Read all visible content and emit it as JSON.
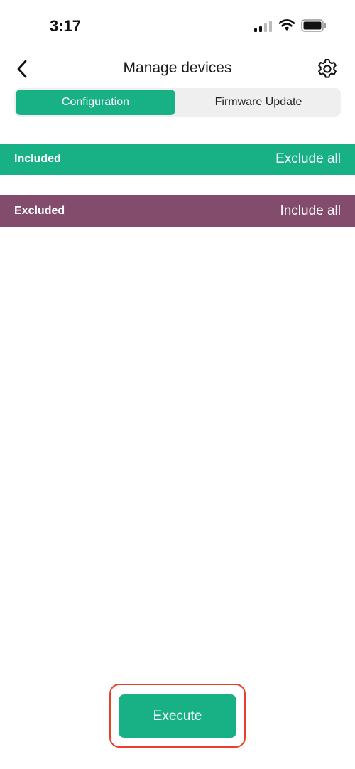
{
  "status_bar": {
    "time": "3:17",
    "icons": [
      "signal-icon",
      "wifi-icon",
      "battery-icon"
    ]
  },
  "nav": {
    "title": "Manage devices",
    "back_icon": "chevron-left-icon",
    "settings_icon": "gear-icon"
  },
  "tabs": [
    {
      "label": "Configuration",
      "active": true
    },
    {
      "label": "Firmware Update",
      "active": false
    }
  ],
  "sections": {
    "included": {
      "label": "Included",
      "action": "Exclude all"
    },
    "excluded": {
      "label": "Excluded",
      "action": "Include all"
    }
  },
  "footer": {
    "execute_label": "Execute"
  },
  "colors": {
    "accent": "#17b185",
    "excluded": "#834b6c",
    "highlight": "#e8402b"
  }
}
